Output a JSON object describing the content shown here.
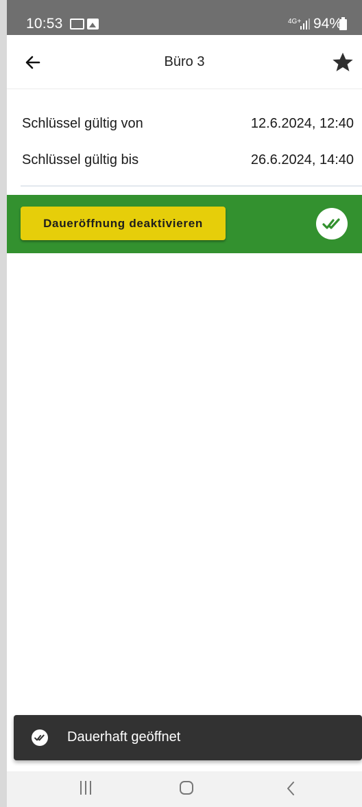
{
  "status_bar": {
    "time": "10:53",
    "network": "4G+",
    "battery": "94%"
  },
  "header": {
    "title": "Büro 3",
    "back_icon": "arrow-left-icon",
    "favorite_icon": "star-icon"
  },
  "key_validity": {
    "from_label": "Schlüssel gültig von",
    "from_value": "12.6.2024, 12:40",
    "until_label": "Schlüssel gültig bis",
    "until_value": "26.6.2024, 14:40"
  },
  "status_bar_green": {
    "button_label": "Daueröffnung deaktivieren",
    "status_icon": "double-check-icon",
    "color": "#33912f",
    "button_color": "#e6ce0a"
  },
  "snackbar": {
    "icon": "double-check-icon",
    "message": "Dauerhaft geöffnet"
  },
  "nav_bar": {
    "recents_icon": "recents-icon",
    "home_icon": "home-icon",
    "back_icon": "back-chevron-icon"
  }
}
